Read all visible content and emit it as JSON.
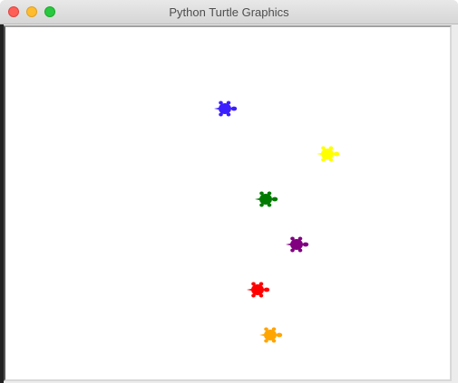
{
  "window": {
    "title": "Python Turtle Graphics"
  },
  "turtles": [
    {
      "name": "turtle-blue",
      "color": "#3b1fff"
    },
    {
      "name": "turtle-yellow",
      "color": "#ffff00"
    },
    {
      "name": "turtle-green",
      "color": "#007a00"
    },
    {
      "name": "turtle-purple",
      "color": "#800080"
    },
    {
      "name": "turtle-red",
      "color": "#ff0000"
    },
    {
      "name": "turtle-orange",
      "color": "#ffa500"
    }
  ]
}
